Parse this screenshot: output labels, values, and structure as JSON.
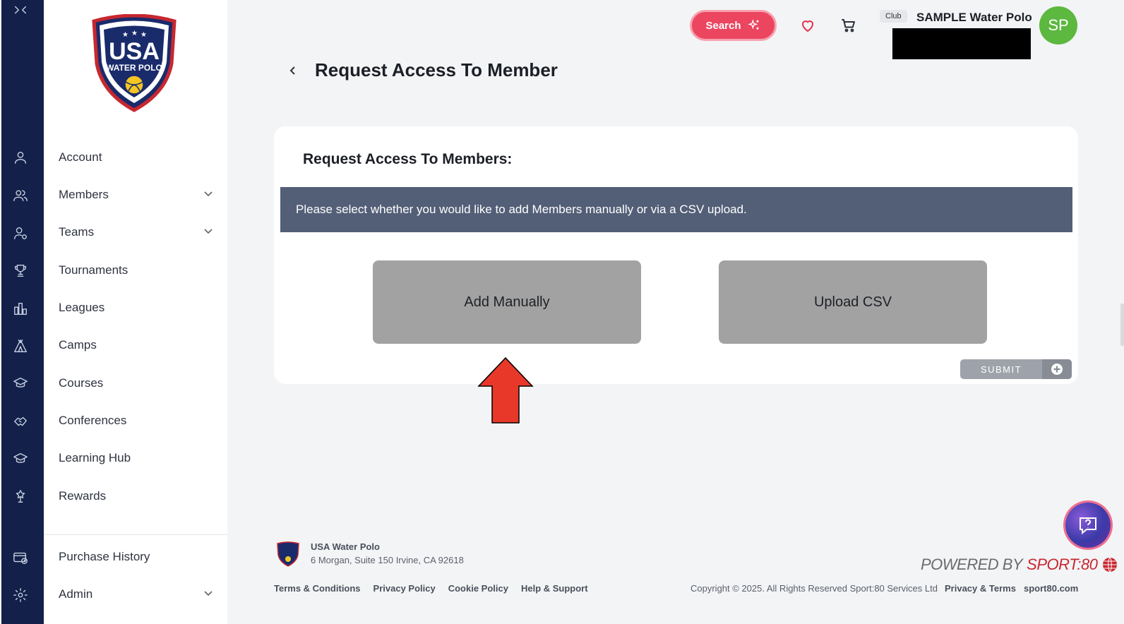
{
  "header": {
    "search_label": "Search",
    "club_tag": "Club",
    "club_name": "SAMPLE Water Polo",
    "avatar_initials": "SP"
  },
  "sidebar": {
    "items": [
      {
        "label": "Account",
        "icon": "user-icon",
        "expandable": false
      },
      {
        "label": "Members",
        "icon": "users-icon",
        "expandable": true
      },
      {
        "label": "Teams",
        "icon": "team-icon",
        "expandable": true
      },
      {
        "label": "Tournaments",
        "icon": "trophy-icon",
        "expandable": false
      },
      {
        "label": "Leagues",
        "icon": "leagues-icon",
        "expandable": false
      },
      {
        "label": "Camps",
        "icon": "tent-icon",
        "expandable": false
      },
      {
        "label": "Courses",
        "icon": "graduation-cap-icon",
        "expandable": false
      },
      {
        "label": "Conferences",
        "icon": "handshake-icon",
        "expandable": false
      },
      {
        "label": "Learning Hub",
        "icon": "graduation-cap-icon",
        "expandable": false
      },
      {
        "label": "Rewards",
        "icon": "award-icon",
        "expandable": false
      },
      {
        "label": "Purchase History",
        "icon": "card-clock-icon",
        "expandable": false
      },
      {
        "label": "Admin",
        "icon": "gear-icon",
        "expandable": true
      }
    ]
  },
  "logo": {
    "line1": "USA",
    "line2": "WATER POLO"
  },
  "page": {
    "title": "Request Access To Member"
  },
  "card": {
    "title": "Request Access To Members:",
    "banner_text": "Please select whether you would like to add Members manually or via a CSV upload.",
    "add_manually_label": "Add Manually",
    "upload_csv_label": "Upload CSV",
    "submit_label": "SUBMIT"
  },
  "footer": {
    "org_name": "USA Water Polo",
    "address": "6 Morgan, Suite 150 Irvine, CA 92618",
    "links": [
      "Terms & Conditions",
      "Privacy Policy",
      "Cookie Policy",
      "Help & Support"
    ],
    "powered_by": "POWERED BY",
    "powered_brand": "SPORT:80",
    "copyright": "Copyright © 2025. All Rights Reserved Sport:80 Services Ltd",
    "privacy_terms": "Privacy & Terms",
    "site": "sport80.com"
  },
  "colors": {
    "rail": "#13214a",
    "search_button": "#ec4560",
    "banner": "#535f77",
    "choice_button": "#a2a2a2",
    "avatar": "#5cb83f",
    "annotation_arrow": "#e8382a"
  }
}
